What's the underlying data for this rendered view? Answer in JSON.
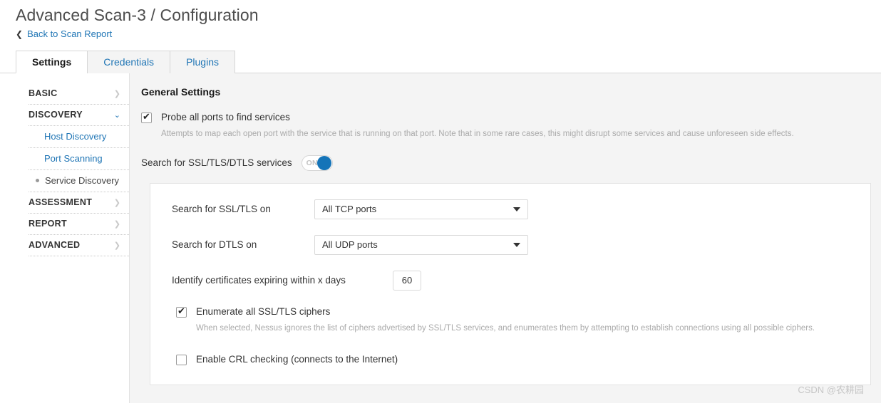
{
  "header": {
    "title": "Advanced Scan-3 / Configuration",
    "back_link": "Back to Scan Report",
    "back_chevron": "❮"
  },
  "tabs": [
    {
      "label": "Settings",
      "active": true
    },
    {
      "label": "Credentials",
      "active": false
    },
    {
      "label": "Plugins",
      "active": false
    }
  ],
  "sidebar": {
    "sections": [
      {
        "label": "BASIC",
        "chevron": "❯",
        "expanded": false
      },
      {
        "label": "DISCOVERY",
        "chevron": "⌄",
        "expanded": true
      }
    ],
    "sub_items": [
      {
        "label": "Host Discovery",
        "active": false
      },
      {
        "label": "Port Scanning",
        "active": false
      },
      {
        "label": "Service Discovery",
        "active": true
      }
    ],
    "sections_after": [
      {
        "label": "ASSESSMENT",
        "chevron": "❯",
        "expanded": false
      },
      {
        "label": "REPORT",
        "chevron": "❯",
        "expanded": false
      },
      {
        "label": "ADVANCED",
        "chevron": "❯",
        "expanded": false
      }
    ]
  },
  "main": {
    "section_title": "General Settings",
    "probe_ports": {
      "label": "Probe all ports to find services",
      "checked": true,
      "help": "Attempts to map each open port with the service that is running on that port. Note that in some rare cases, this might disrupt some services and cause unforeseen side effects."
    },
    "ssl_toggle": {
      "caption": "Search for SSL/TLS/DTLS services",
      "state_text": "ON",
      "on": true
    },
    "ssl_on": {
      "label": "Search for SSL/TLS on",
      "value": "All TCP ports"
    },
    "dtls_on": {
      "label": "Search for DTLS on",
      "value": "All UDP ports"
    },
    "cert_expiry": {
      "label": "Identify certificates expiring within x days",
      "value": "60"
    },
    "enumerate_ciphers": {
      "label": "Enumerate all SSL/TLS ciphers",
      "checked": true,
      "help": "When selected, Nessus ignores the list of ciphers advertised by SSL/TLS services, and enumerates them by attempting to establish connections using all possible ciphers."
    },
    "crl_checking": {
      "label": "Enable CRL checking (connects to the Internet)",
      "checked": false
    }
  },
  "watermark": "CSDN @农耕园",
  "colors": {
    "link": "#1f75b5",
    "toggle_on": "#1574b8",
    "panel_bg": "#f4f4f4"
  }
}
